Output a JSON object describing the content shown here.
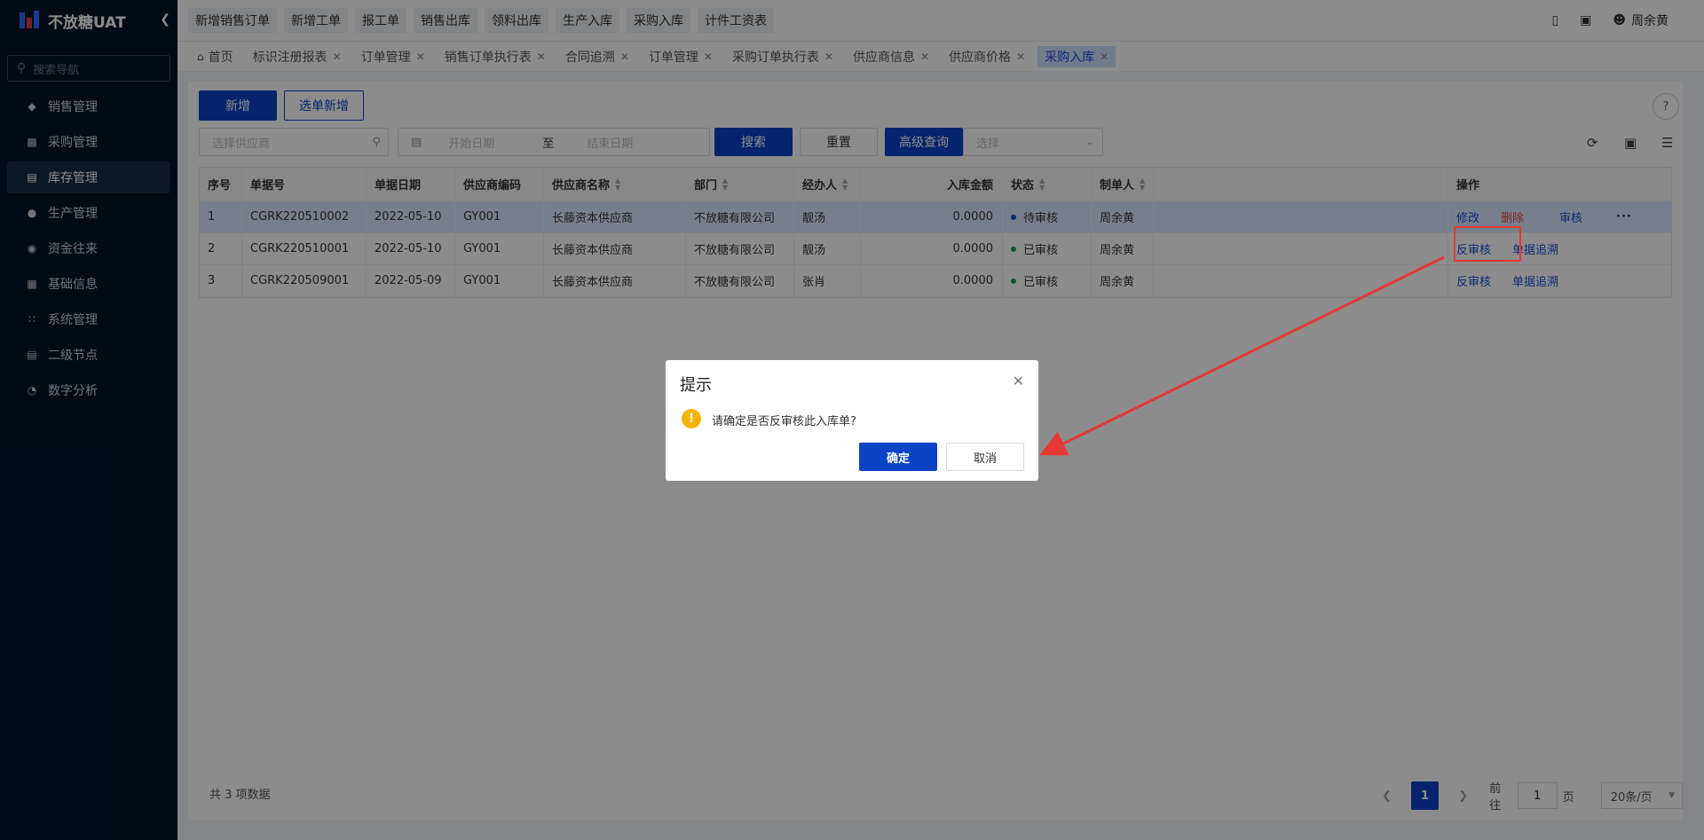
{
  "app": {
    "title": "不放糖UAT"
  },
  "sidebar": {
    "search_placeholder": "搜索导航",
    "items": [
      {
        "label": "销售管理"
      },
      {
        "label": "采购管理"
      },
      {
        "label": "库存管理"
      },
      {
        "label": "生产管理"
      },
      {
        "label": "资金往来"
      },
      {
        "label": "基础信息"
      },
      {
        "label": "系统管理"
      },
      {
        "label": "二级节点"
      },
      {
        "label": "数字分析"
      }
    ]
  },
  "topbar": {
    "quick_buttons": [
      "新增销售订单",
      "新增工单",
      "报工单",
      "销售出库",
      "领料出库",
      "生产入库",
      "采购入库",
      "计件工资表"
    ],
    "user_name": "周余黄"
  },
  "tabs": [
    {
      "label": "首页"
    },
    {
      "label": "标识注册报表"
    },
    {
      "label": "订单管理"
    },
    {
      "label": "销售订单执行表"
    },
    {
      "label": "合同追溯"
    },
    {
      "label": "订单管理"
    },
    {
      "label": "采购订单执行表"
    },
    {
      "label": "供应商信息"
    },
    {
      "label": "供应商价格"
    },
    {
      "label": "采购入库"
    }
  ],
  "toolbar": {
    "add_label": "新增",
    "select_add_label": "选单新增",
    "supplier_placeholder": "选择供应商",
    "start_date_placeholder": "开始日期",
    "date_sep": "至",
    "end_date_placeholder": "结束日期",
    "search_label": "搜索",
    "reset_label": "重置",
    "advanced_label": "高级查询",
    "select_placeholder": "选择"
  },
  "table": {
    "headers": [
      "序号",
      "单据号",
      "单据日期",
      "供应商编码",
      "供应商名称",
      "部门",
      "经办人",
      "入库金额",
      "状态",
      "制单人",
      "操作"
    ],
    "rows": [
      {
        "idx": "1",
        "doc_no": "CGRK220510002",
        "date": "2022-05-10",
        "supplier_code": "GY001",
        "supplier_name": "长藤资本供应商",
        "dept": "不放糖有限公司",
        "handler": "靓汤",
        "amount": "0.0000",
        "status": "待审核",
        "status_color": "#1a4fd6",
        "maker": "周余黄",
        "actions": [
          "修改",
          "删除",
          "审核"
        ]
      },
      {
        "idx": "2",
        "doc_no": "CGRK220510001",
        "date": "2022-05-10",
        "supplier_code": "GY001",
        "supplier_name": "长藤资本供应商",
        "dept": "不放糖有限公司",
        "handler": "靓汤",
        "amount": "0.0000",
        "status": "已审核",
        "status_color": "#1e9e5a",
        "maker": "周余黄",
        "actions": [
          "反审核",
          "单据追溯"
        ]
      },
      {
        "idx": "3",
        "doc_no": "CGRK220509001",
        "date": "2022-05-09",
        "supplier_code": "GY001",
        "supplier_name": "长藤资本供应商",
        "dept": "不放糖有限公司",
        "handler": "张肖",
        "amount": "0.0000",
        "status": "已审核",
        "status_color": "#1e9e5a",
        "maker": "周余黄",
        "actions": [
          "反审核",
          "单据追溯"
        ]
      }
    ]
  },
  "footer": {
    "total": "共 3 项数据",
    "current_page": "1",
    "goto_label": "前往",
    "goto_value": "1",
    "page_unit": "页",
    "page_size": "20条/页"
  },
  "modal": {
    "title": "提示",
    "message": "请确定是否反审核此入库单?",
    "ok_label": "确定",
    "cancel_label": "取消"
  },
  "colors": {
    "primary": "#0a43c6",
    "danger": "#e74c3c",
    "annotation": "#e53935"
  }
}
